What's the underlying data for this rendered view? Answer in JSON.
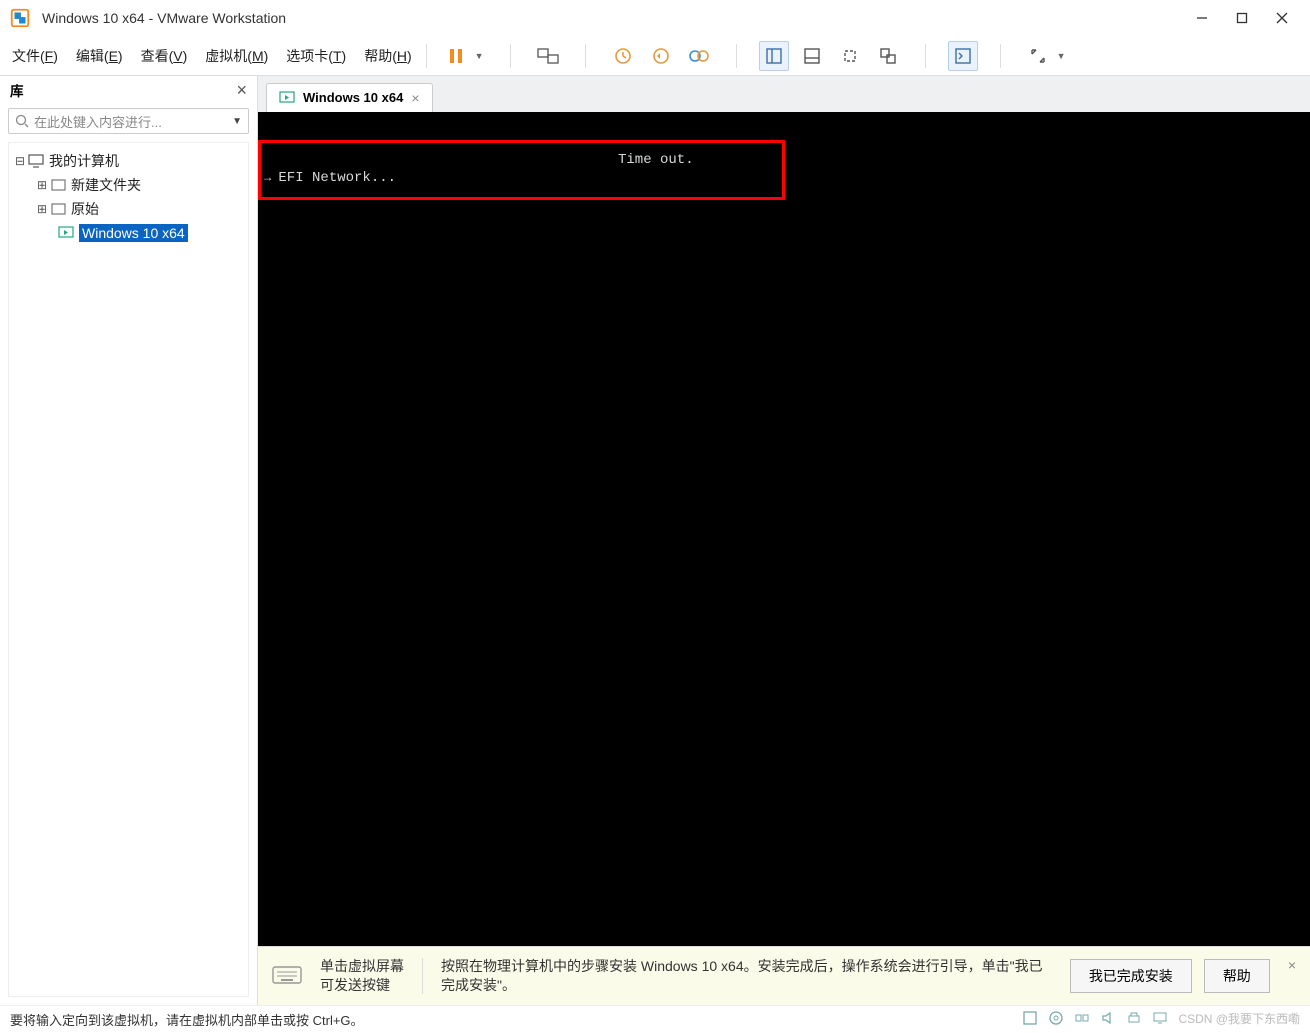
{
  "window": {
    "title": "Windows 10 x64 - VMware Workstation"
  },
  "menubar": [
    {
      "label": "文件",
      "key": "F"
    },
    {
      "label": "编辑",
      "key": "E"
    },
    {
      "label": "查看",
      "key": "V"
    },
    {
      "label": "虚拟机",
      "key": "M"
    },
    {
      "label": "选项卡",
      "key": "T"
    },
    {
      "label": "帮助",
      "key": "H"
    }
  ],
  "library": {
    "title": "库",
    "search_placeholder": "在此处键入内容进行...",
    "tree": {
      "root": "我的计算机",
      "children": [
        {
          "label": "新建文件夹",
          "type": "folder"
        },
        {
          "label": "原始",
          "type": "folder"
        },
        {
          "label": "Windows 10 x64",
          "type": "vm",
          "selected": true
        }
      ]
    }
  },
  "tabs": [
    {
      "label": "Windows 10 x64"
    }
  ],
  "console": {
    "line1": "Time out.",
    "line2": "EFI Network..."
  },
  "banner": {
    "col1_line1": "单击虚拟屏幕",
    "col1_line2": "可发送按键",
    "col2": "按照在物理计算机中的步骤安装 Windows 10 x64。安装完成后，操作系统会进行引导，单击\"我已完成安装\"。",
    "button_done": "我已完成安装",
    "button_help": "帮助"
  },
  "statusbar": {
    "text": "要将输入定向到该虚拟机，请在虚拟机内部单击或按 Ctrl+G。",
    "watermark": "CSDN @我要下东西嘞"
  }
}
